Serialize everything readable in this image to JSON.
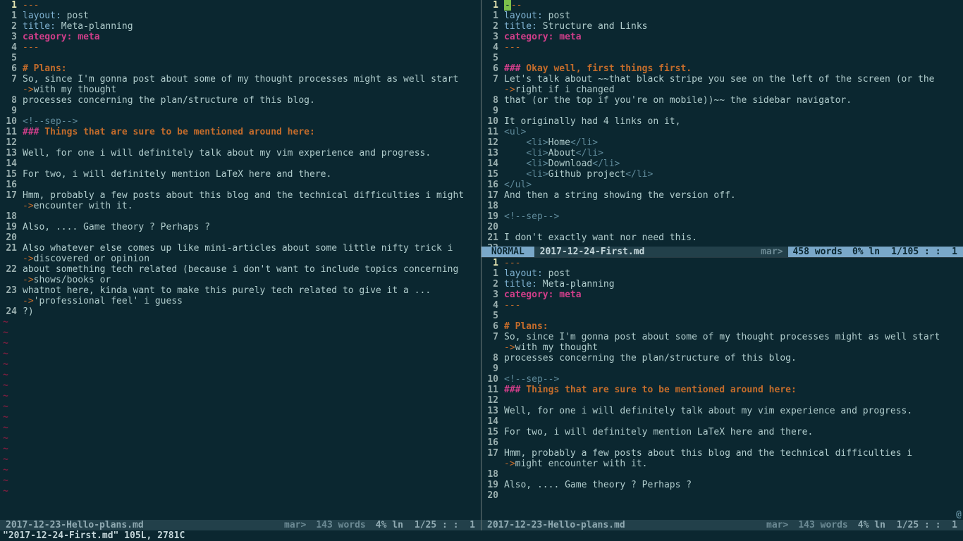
{
  "left": {
    "lines": [
      {
        "n": "1",
        "seg": [
          {
            "c": "punct",
            "t": "---"
          }
        ],
        "cur": true
      },
      {
        "n": "1",
        "seg": [
          {
            "c": "key",
            "t": "layout:"
          },
          {
            "c": "txt",
            "t": " post"
          }
        ]
      },
      {
        "n": "2",
        "seg": [
          {
            "c": "key",
            "t": "title:"
          },
          {
            "c": "txt",
            "t": " Meta-planning"
          }
        ]
      },
      {
        "n": "3",
        "seg": [
          {
            "c": "magenta",
            "t": "category: meta"
          }
        ]
      },
      {
        "n": "4",
        "seg": [
          {
            "c": "punct",
            "t": "---"
          }
        ]
      },
      {
        "n": "5",
        "seg": []
      },
      {
        "n": "6",
        "seg": [
          {
            "c": "heading",
            "t": "# Plans:"
          }
        ]
      },
      {
        "n": "7",
        "seg": [
          {
            "c": "txt",
            "t": "So, since I'm gonna post about some of my thought processes might as well start "
          }
        ]
      },
      {
        "n": "",
        "seg": [
          {
            "c": "wrap",
            "t": "->"
          },
          {
            "c": "txt",
            "t": "with my thought"
          }
        ]
      },
      {
        "n": "8",
        "seg": [
          {
            "c": "txt",
            "t": "processes concerning the plan/structure of this blog."
          }
        ]
      },
      {
        "n": "9",
        "seg": []
      },
      {
        "n": "10",
        "seg": [
          {
            "c": "comment",
            "t": "<!--sep-->"
          }
        ]
      },
      {
        "n": "11",
        "seg": [
          {
            "c": "hash3",
            "t": "###"
          },
          {
            "c": "heading",
            "t": " Things that are sure to be mentioned around here:"
          }
        ]
      },
      {
        "n": "12",
        "seg": []
      },
      {
        "n": "13",
        "seg": [
          {
            "c": "txt",
            "t": "Well, for one i will definitely talk about my vim experience and progress."
          }
        ]
      },
      {
        "n": "14",
        "seg": []
      },
      {
        "n": "15",
        "seg": [
          {
            "c": "txt",
            "t": "For two, i will definitely mention LaTeX here and there."
          }
        ]
      },
      {
        "n": "16",
        "seg": []
      },
      {
        "n": "17",
        "seg": [
          {
            "c": "txt",
            "t": "Hmm, probably a few posts about this blog and the technical difficulties i might "
          }
        ]
      },
      {
        "n": "",
        "seg": [
          {
            "c": "wrap",
            "t": "->"
          },
          {
            "c": "txt",
            "t": "encounter with it."
          }
        ]
      },
      {
        "n": "18",
        "seg": []
      },
      {
        "n": "19",
        "seg": [
          {
            "c": "txt",
            "t": "Also, .... Game theory ? Perhaps ?"
          }
        ]
      },
      {
        "n": "20",
        "seg": []
      },
      {
        "n": "21",
        "seg": [
          {
            "c": "txt",
            "t": "Also whatever else comes up like mini-articles about some little nifty trick i "
          }
        ]
      },
      {
        "n": "",
        "seg": [
          {
            "c": "wrap",
            "t": "->"
          },
          {
            "c": "txt",
            "t": "discovered or opinion"
          }
        ]
      },
      {
        "n": "22",
        "seg": [
          {
            "c": "txt",
            "t": "about something tech related (because i don't want to include topics concerning "
          }
        ]
      },
      {
        "n": "",
        "seg": [
          {
            "c": "wrap",
            "t": "->"
          },
          {
            "c": "txt",
            "t": "shows/books or"
          }
        ]
      },
      {
        "n": "23",
        "seg": [
          {
            "c": "txt",
            "t": "whatnot here, kinda want to make this purely tech related to give it a ... "
          }
        ]
      },
      {
        "n": "",
        "seg": [
          {
            "c": "wrap",
            "t": "->"
          },
          {
            "c": "txt",
            "t": "'professional feel' i guess"
          }
        ]
      },
      {
        "n": "24",
        "seg": [
          {
            "c": "txt",
            "t": "?)"
          }
        ]
      }
    ],
    "tildes": 17,
    "status": {
      "file": "2017-12-23-Hello-plans.md",
      "branch": "mar>",
      "words": "143 words",
      "pct": "4% ln",
      "pos": "1/25 : :  1"
    }
  },
  "right_top": {
    "lines": [
      {
        "n": "1",
        "seg": [
          {
            "c": "cursor",
            "t": "-"
          },
          {
            "c": "punct",
            "t": "--"
          }
        ],
        "cur": true
      },
      {
        "n": "1",
        "seg": [
          {
            "c": "key",
            "t": "layout:"
          },
          {
            "c": "txt",
            "t": " post"
          }
        ]
      },
      {
        "n": "2",
        "seg": [
          {
            "c": "key",
            "t": "title:"
          },
          {
            "c": "txt",
            "t": " Structure and Links"
          }
        ]
      },
      {
        "n": "3",
        "seg": [
          {
            "c": "magenta",
            "t": "category: meta"
          }
        ]
      },
      {
        "n": "4",
        "seg": [
          {
            "c": "punct",
            "t": "---"
          }
        ]
      },
      {
        "n": "5",
        "seg": []
      },
      {
        "n": "6",
        "seg": [
          {
            "c": "hash3",
            "t": "###"
          },
          {
            "c": "heading",
            "t": " Okay well, first things first."
          }
        ]
      },
      {
        "n": "7",
        "seg": [
          {
            "c": "txt",
            "t": "Let's talk about ~~that black stripe you see on the left of the screen (or the "
          }
        ]
      },
      {
        "n": "",
        "seg": [
          {
            "c": "wrap",
            "t": "->"
          },
          {
            "c": "txt",
            "t": "right if i changed"
          }
        ]
      },
      {
        "n": "8",
        "seg": [
          {
            "c": "txt",
            "t": "that (or the top if you're on mobile))~~ the sidebar navigator."
          }
        ]
      },
      {
        "n": "9",
        "seg": []
      },
      {
        "n": "10",
        "seg": [
          {
            "c": "txt",
            "t": "It originally had 4 links on it,"
          }
        ]
      },
      {
        "n": "11",
        "seg": [
          {
            "c": "tag",
            "t": "<ul>"
          }
        ]
      },
      {
        "n": "12",
        "seg": [
          {
            "c": "txt",
            "t": "    "
          },
          {
            "c": "tag",
            "t": "<li>"
          },
          {
            "c": "txt",
            "t": "Home"
          },
          {
            "c": "tag",
            "t": "</li>"
          }
        ]
      },
      {
        "n": "13",
        "seg": [
          {
            "c": "txt",
            "t": "    "
          },
          {
            "c": "tag",
            "t": "<li>"
          },
          {
            "c": "txt",
            "t": "About"
          },
          {
            "c": "tag",
            "t": "</li>"
          }
        ]
      },
      {
        "n": "14",
        "seg": [
          {
            "c": "txt",
            "t": "    "
          },
          {
            "c": "tag",
            "t": "<li>"
          },
          {
            "c": "txt",
            "t": "Download"
          },
          {
            "c": "tag",
            "t": "</li>"
          }
        ]
      },
      {
        "n": "15",
        "seg": [
          {
            "c": "txt",
            "t": "    "
          },
          {
            "c": "tag",
            "t": "<li>"
          },
          {
            "c": "txt",
            "t": "Github project"
          },
          {
            "c": "tag",
            "t": "</li>"
          }
        ]
      },
      {
        "n": "16",
        "seg": [
          {
            "c": "tag",
            "t": "</ul>"
          }
        ]
      },
      {
        "n": "17",
        "seg": [
          {
            "c": "txt",
            "t": "And then a string showing the version off."
          }
        ]
      },
      {
        "n": "18",
        "seg": []
      },
      {
        "n": "19",
        "seg": [
          {
            "c": "comment",
            "t": "<!--sep-->"
          }
        ]
      },
      {
        "n": "20",
        "seg": []
      },
      {
        "n": "21",
        "seg": [
          {
            "c": "txt",
            "t": "I don't exactly want nor need this."
          }
        ]
      },
      {
        "n": "22",
        "seg": []
      }
    ],
    "status": {
      "mode": " NORMAL ",
      "file": "2017-12-24-First.md",
      "branch": "mar>",
      "words": "458 words",
      "pct": "0% ln",
      "pos": "1/105 : :  1"
    }
  },
  "right_bot": {
    "lines": [
      {
        "n": "1",
        "seg": [
          {
            "c": "punct",
            "t": "---"
          }
        ],
        "cur": true
      },
      {
        "n": "1",
        "seg": [
          {
            "c": "key",
            "t": "layout:"
          },
          {
            "c": "txt",
            "t": " post"
          }
        ]
      },
      {
        "n": "2",
        "seg": [
          {
            "c": "key",
            "t": "title:"
          },
          {
            "c": "txt",
            "t": " Meta-planning"
          }
        ]
      },
      {
        "n": "3",
        "seg": [
          {
            "c": "magenta",
            "t": "category: meta"
          }
        ]
      },
      {
        "n": "4",
        "seg": [
          {
            "c": "punct",
            "t": "---"
          }
        ]
      },
      {
        "n": "5",
        "seg": []
      },
      {
        "n": "6",
        "seg": [
          {
            "c": "heading",
            "t": "# Plans:"
          }
        ]
      },
      {
        "n": "7",
        "seg": [
          {
            "c": "txt",
            "t": "So, since I'm gonna post about some of my thought processes might as well start "
          }
        ]
      },
      {
        "n": "",
        "seg": [
          {
            "c": "wrap",
            "t": "->"
          },
          {
            "c": "txt",
            "t": "with my thought"
          }
        ]
      },
      {
        "n": "8",
        "seg": [
          {
            "c": "txt",
            "t": "processes concerning the plan/structure of this blog."
          }
        ]
      },
      {
        "n": "9",
        "seg": []
      },
      {
        "n": "10",
        "seg": [
          {
            "c": "comment",
            "t": "<!--sep-->"
          }
        ]
      },
      {
        "n": "11",
        "seg": [
          {
            "c": "hash3",
            "t": "###"
          },
          {
            "c": "heading",
            "t": " Things that are sure to be mentioned around here:"
          }
        ]
      },
      {
        "n": "12",
        "seg": []
      },
      {
        "n": "13",
        "seg": [
          {
            "c": "txt",
            "t": "Well, for one i will definitely talk about my vim experience and progress."
          }
        ]
      },
      {
        "n": "14",
        "seg": []
      },
      {
        "n": "15",
        "seg": [
          {
            "c": "txt",
            "t": "For two, i will definitely mention LaTeX here and there."
          }
        ]
      },
      {
        "n": "16",
        "seg": []
      },
      {
        "n": "17",
        "seg": [
          {
            "c": "txt",
            "t": "Hmm, probably a few posts about this blog and the technical difficulties i "
          }
        ]
      },
      {
        "n": "",
        "seg": [
          {
            "c": "wrap",
            "t": "->"
          },
          {
            "c": "txt",
            "t": "might encounter with it."
          }
        ]
      },
      {
        "n": "18",
        "seg": []
      },
      {
        "n": "19",
        "seg": [
          {
            "c": "txt",
            "t": "Also, .... Game theory ? Perhaps ?"
          }
        ]
      },
      {
        "n": "20",
        "seg": []
      }
    ],
    "status": {
      "file": "2017-12-23-Hello-plans.md",
      "branch": "mar>",
      "words": "143 words",
      "pct": "4% ln",
      "pos": "1/25 : :  1"
    },
    "at": "@"
  },
  "cmdline": "\"2017-12-24-First.md\" 105L, 2781C"
}
